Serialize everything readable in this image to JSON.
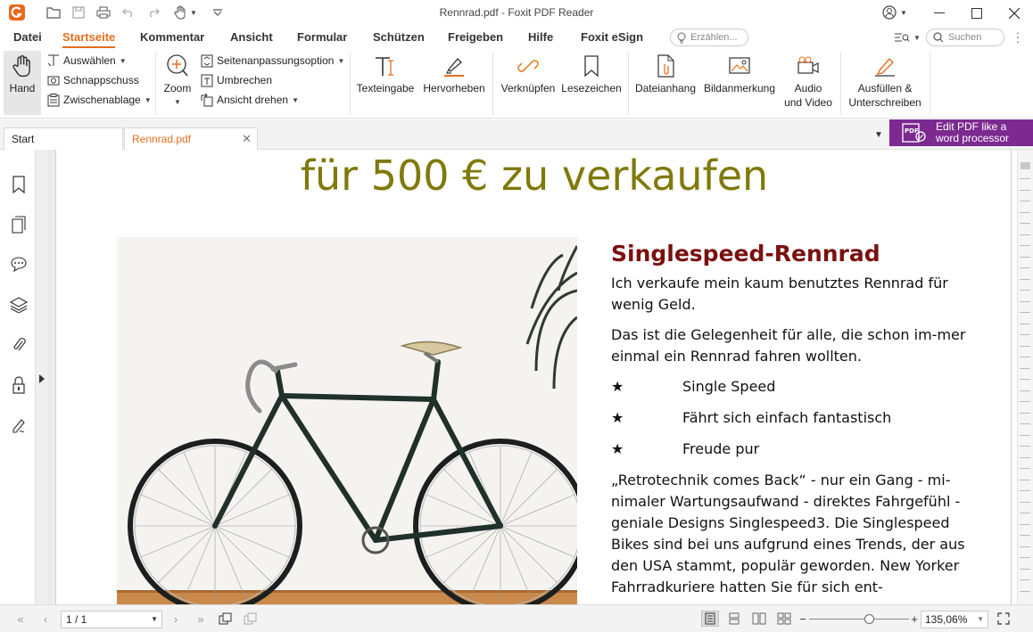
{
  "window": {
    "title": "Rennrad.pdf - Foxit PDF Reader"
  },
  "menu": [
    {
      "label": "Datei"
    },
    {
      "label": "Startseite"
    },
    {
      "label": "Kommentar"
    },
    {
      "label": "Ansicht"
    },
    {
      "label": "Formular"
    },
    {
      "label": "Schützen"
    },
    {
      "label": "Freigeben"
    },
    {
      "label": "Hilfe"
    },
    {
      "label": "Foxit eSign"
    }
  ],
  "tellme_placeholder": "Erzählen...",
  "search_placeholder": "Suchen",
  "ribbon": {
    "hand": "Hand",
    "select": "Auswählen",
    "snapshot": "Schnappschuss",
    "clipboard": "Zwischenablage",
    "zoom": "Zoom",
    "page_fit": "Seitenanpassungsoption",
    "reflow": "Umbrechen",
    "rotate": "Ansicht drehen",
    "typewriter": "Texteingabe",
    "highlight": "Hervorheben",
    "link": "Verknüpfen",
    "bookmark": "Lesezeichen",
    "attachment": "Dateianhang",
    "image_annotation": "Bildanmerkung",
    "audio_video_1": "Audio",
    "audio_video_2": "und Video",
    "fill_sign_1": "Ausfüllen &",
    "fill_sign_2": "Unterschreiben"
  },
  "tabs": [
    {
      "label": "Start"
    },
    {
      "label": "Rennrad.pdf"
    }
  ],
  "promo": {
    "line1": "Edit PDF like a",
    "line2": "word processor"
  },
  "document": {
    "heading": "für 500 € zu verkaufen",
    "article_title": "Singlespeed-Rennrad",
    "para1": "Ich verkaufe mein kaum benutztes Rennrad für wenig Geld.",
    "para2": "Das ist die Gelegenheit für alle, die schon im-mer einmal ein Rennrad fahren wollten.",
    "bullets": [
      {
        "star": "★",
        "text": "Single Speed"
      },
      {
        "star": "★",
        "text": "Fährt sich einfach fantastisch"
      },
      {
        "star": "★",
        "text": "Freude pur"
      }
    ],
    "para3": "„Retrotechnik comes Back“ - nur ein Gang - mi-nimaler Wartungsaufwand - direktes Fahrgefühl - geniale Designs Singlespeed3. Die Singlespeed Bikes sind bei uns aufgrund eines Trends, der aus den USA stammt, populär geworden. New Yorker Fahrradkuriere hatten Sie für sich ent-"
  },
  "status": {
    "page": "1 / 1",
    "zoom": "135,06%",
    "zoom_fraction": 0.6
  }
}
